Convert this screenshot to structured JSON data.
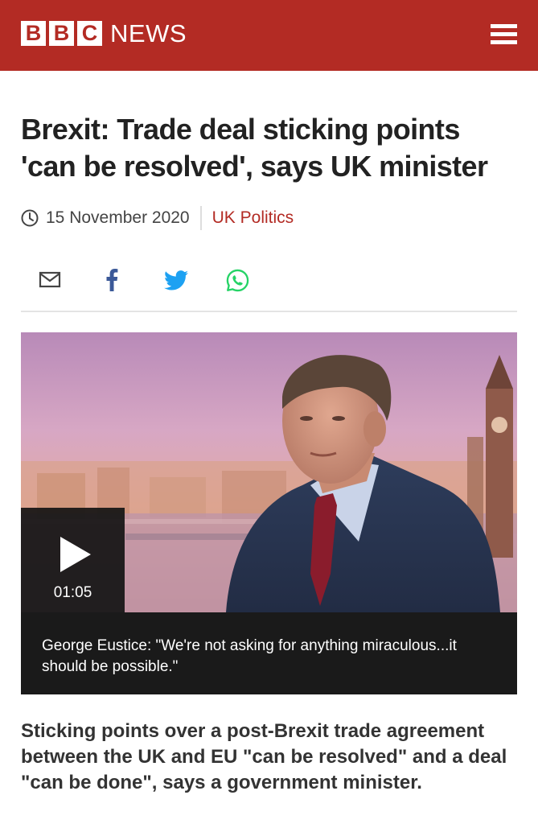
{
  "header": {
    "logo_letters": [
      "B",
      "B",
      "C"
    ],
    "logo_news": "NEWS",
    "menu_icon": "hamburger-menu-icon",
    "background_color": "#b32b24"
  },
  "article": {
    "title": "Brexit: Trade deal sticking points 'can be resolved', says UK minister",
    "date": "15 November 2020",
    "section": "UK Politics",
    "section_color": "#b32b24"
  },
  "share": {
    "icons": [
      "email-icon",
      "facebook-icon",
      "twitter-icon",
      "whatsapp-icon"
    ],
    "colors": {
      "email": "#444444",
      "facebook": "#3b5998",
      "twitter": "#1da1f2",
      "whatsapp": "#25d366"
    }
  },
  "media": {
    "duration": "01:05",
    "caption": "George Eustice: \"We're not asking for anything miraculous...it should be possible.\""
  },
  "summary": "Sticking points over a post-Brexit trade agreement between the UK and EU \"can be resolved\" and a deal \"can be done\", says a government minister."
}
